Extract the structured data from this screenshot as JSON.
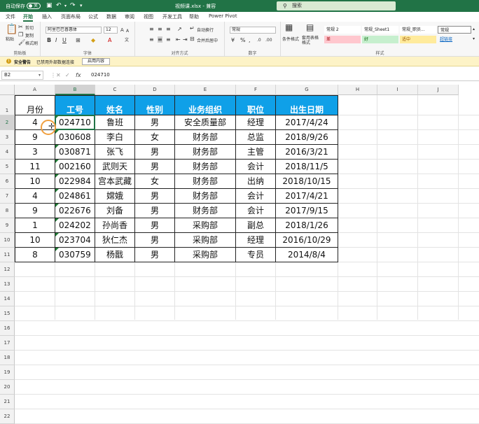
{
  "titlebar": {
    "autosave_label": "自动保存",
    "toggle_state": "关",
    "doc_title": "视频课.xlsx - 兼容",
    "search_placeholder": "搜索"
  },
  "menu_tabs": [
    "文件",
    "开始",
    "插入",
    "页面布局",
    "公式",
    "数据",
    "审阅",
    "视图",
    "开发工具",
    "帮助",
    "Power Pivot"
  ],
  "active_tab": "开始",
  "ribbon": {
    "clipboard": {
      "paste": "粘贴",
      "cut": "剪切",
      "copy": "复制",
      "format_painter": "格式刷",
      "label": "剪贴板"
    },
    "font": {
      "name": "阿里巴巴普惠体",
      "size": "12",
      "label": "字体"
    },
    "alignment": {
      "wrap": "自动换行",
      "merge": "合并后居中",
      "label": "对齐方式"
    },
    "number": {
      "format": "常规",
      "label": "数字"
    },
    "styles": {
      "conditional": "条件格式",
      "table_format": "套用表格格式",
      "cells": [
        "常规 2",
        "常规_Sheet1",
        "常规_职员...",
        "常规",
        "差",
        "好",
        "适中",
        "超链接"
      ],
      "label": "样式"
    }
  },
  "security_bar": {
    "title": "安全警告",
    "message": "已禁用外部数据连接",
    "button": "启用内容"
  },
  "formula_bar": {
    "name_box": "B2",
    "fx": "fx",
    "value": "024710"
  },
  "sheet": {
    "columns": [
      "A",
      "B",
      "C",
      "D",
      "E",
      "F",
      "G",
      "H",
      "I",
      "J"
    ],
    "selected_column": "B",
    "selected_row": "2",
    "header_row": [
      "月份",
      "工号",
      "姓名",
      "性别",
      "业务组织",
      "职位",
      "出生日期"
    ],
    "rows": [
      {
        "num": "2",
        "cells": [
          "4",
          "024710",
          "鲁班",
          "男",
          "安全质量部",
          "经理",
          "2017/4/24"
        ]
      },
      {
        "num": "3",
        "cells": [
          "9",
          "030608",
          "李白",
          "女",
          "财务部",
          "总监",
          "2018/9/26"
        ]
      },
      {
        "num": "4",
        "cells": [
          "3",
          "030871",
          "张飞",
          "男",
          "财务部",
          "主管",
          "2016/3/21"
        ]
      },
      {
        "num": "5",
        "cells": [
          "11",
          "002160",
          "武则天",
          "男",
          "财务部",
          "会计",
          "2018/11/5"
        ]
      },
      {
        "num": "6",
        "cells": [
          "10",
          "022984",
          "宫本武藏",
          "女",
          "财务部",
          "出纳",
          "2018/10/15"
        ]
      },
      {
        "num": "7",
        "cells": [
          "4",
          "024861",
          "嫦娥",
          "男",
          "财务部",
          "会计",
          "2017/4/21"
        ]
      },
      {
        "num": "8",
        "cells": [
          "9",
          "022676",
          "刘备",
          "男",
          "财务部",
          "会计",
          "2017/9/15"
        ]
      },
      {
        "num": "9",
        "cells": [
          "1",
          "024202",
          "孙尚香",
          "男",
          "采购部",
          "副总",
          "2018/1/26"
        ]
      },
      {
        "num": "10",
        "cells": [
          "10",
          "023704",
          "狄仁杰",
          "男",
          "采购部",
          "经理",
          "2016/10/29"
        ]
      },
      {
        "num": "11",
        "cells": [
          "8",
          "030759",
          "杨戬",
          "男",
          "采购部",
          "专员",
          "2014/8/4"
        ]
      }
    ],
    "extra_rows": [
      "12",
      "13",
      "14",
      "15",
      "16",
      "17",
      "18",
      "19",
      "20",
      "21",
      "22"
    ]
  }
}
